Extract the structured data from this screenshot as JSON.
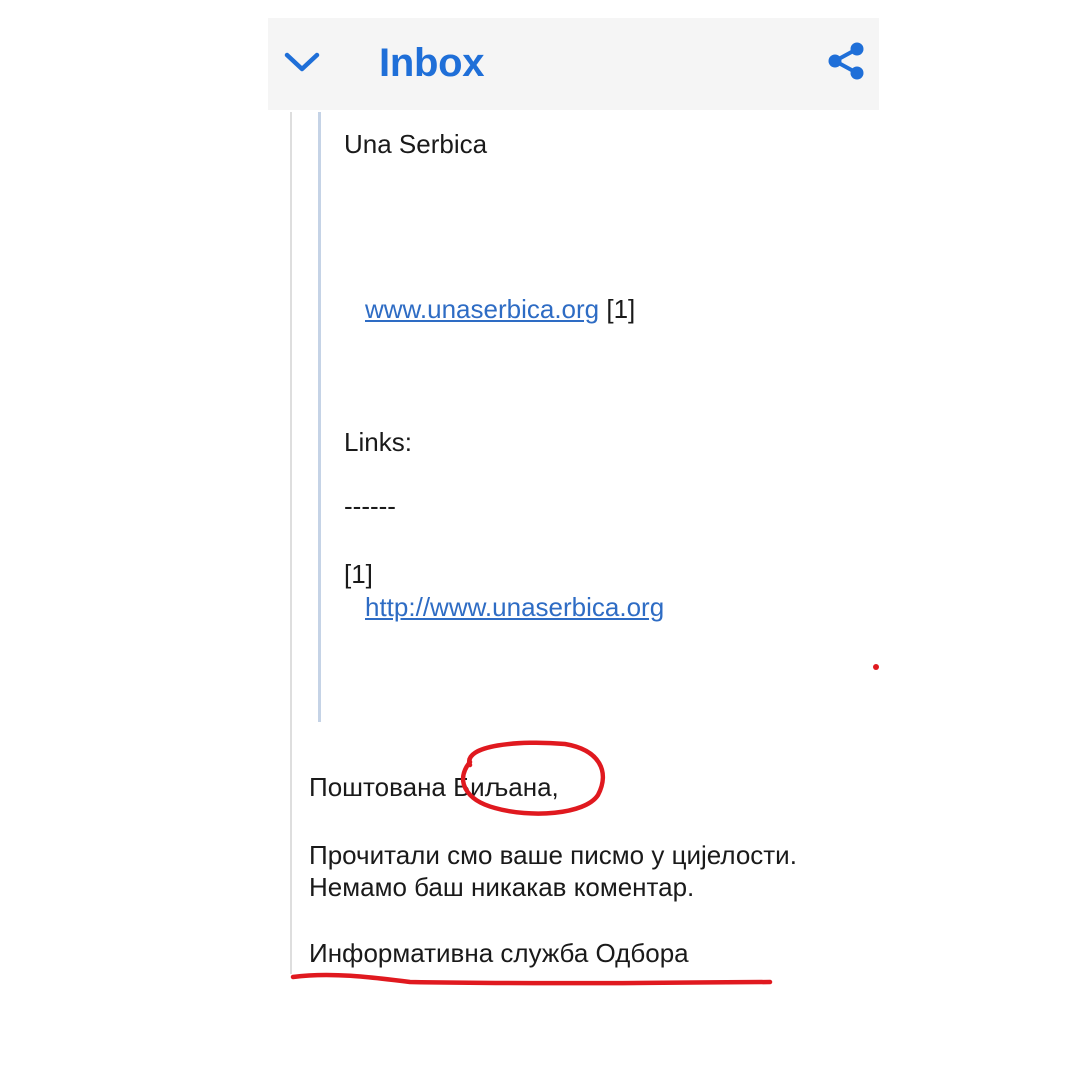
{
  "header": {
    "title": "Inbox",
    "back_icon": "chevron-down-icon",
    "share_icon": "share-icon"
  },
  "quoted": {
    "signature_name": "Una Serbica",
    "website_link": "www.unaserbica.org",
    "website_ref": "[1]",
    "links_heading": "Links:",
    "separator": "------",
    "ref_number": "[1]",
    "ref_url": "http://www.unaserbica.org"
  },
  "reply": {
    "greeting_prefix": "Поштована ",
    "greeting_name": "Биљана,",
    "line1": "Прочитали смо ваше писмо у цијелости.",
    "line2": "Немамо баш никакав коментар.",
    "signature": "Информативна служба Одбора"
  },
  "colors": {
    "accent": "#1f6fd8",
    "link": "#2e6cc4",
    "annotation": "#e0191f"
  }
}
